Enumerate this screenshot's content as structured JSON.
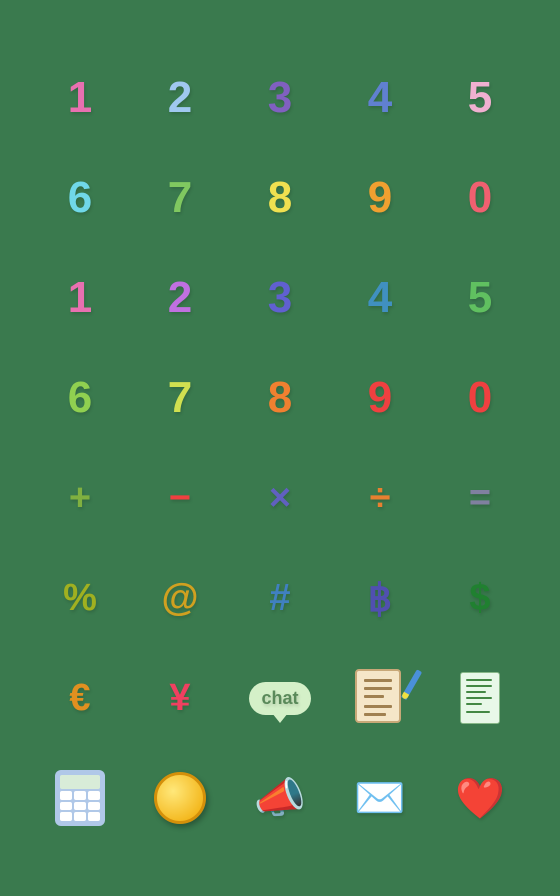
{
  "background": "#3a7a4e",
  "rows": [
    {
      "cells": [
        {
          "label": "1",
          "color": "#e870b0",
          "type": "number"
        },
        {
          "label": "2",
          "color": "#a0c8f0",
          "type": "number"
        },
        {
          "label": "3",
          "color": "#8060c0",
          "type": "number"
        },
        {
          "label": "4",
          "color": "#6080d0",
          "type": "number"
        },
        {
          "label": "5",
          "color": "#f0b0d0",
          "type": "number"
        }
      ]
    },
    {
      "cells": [
        {
          "label": "6",
          "color": "#70d8e8",
          "type": "number"
        },
        {
          "label": "7",
          "color": "#80c860",
          "type": "number"
        },
        {
          "label": "8",
          "color": "#f0e050",
          "type": "number"
        },
        {
          "label": "9",
          "color": "#f0a030",
          "type": "number"
        },
        {
          "label": "0",
          "color": "#f06070",
          "type": "number"
        }
      ]
    },
    {
      "cells": [
        {
          "label": "1",
          "color": "#e870b0",
          "type": "number"
        },
        {
          "label": "2",
          "color": "#c070e0",
          "type": "number"
        },
        {
          "label": "3",
          "color": "#6060d0",
          "type": "number"
        },
        {
          "label": "4",
          "color": "#4090c0",
          "type": "number"
        },
        {
          "label": "5",
          "color": "#60c060",
          "type": "number"
        }
      ]
    },
    {
      "cells": [
        {
          "label": "6",
          "color": "#90d050",
          "type": "number"
        },
        {
          "label": "7",
          "color": "#d0e050",
          "type": "number"
        },
        {
          "label": "8",
          "color": "#f08030",
          "type": "number"
        },
        {
          "label": "9",
          "color": "#f04040",
          "type": "number"
        },
        {
          "label": "0",
          "color": "#f04040",
          "type": "number"
        }
      ]
    },
    {
      "cells": [
        {
          "label": "+",
          "color": "#80b040",
          "type": "symbol"
        },
        {
          "label": "−",
          "color": "#f04040",
          "type": "symbol"
        },
        {
          "label": "×",
          "color": "#6060c0",
          "type": "symbol"
        },
        {
          "label": "÷",
          "color": "#e88030",
          "type": "symbol"
        },
        {
          "label": "=",
          "color": "#8080a0",
          "type": "symbol"
        }
      ]
    },
    {
      "cells": [
        {
          "label": "%",
          "color": "#a0b020",
          "type": "symbol"
        },
        {
          "label": "@",
          "color": "#d0a020",
          "type": "symbol"
        },
        {
          "label": "#",
          "color": "#4080c0",
          "type": "symbol"
        },
        {
          "label": "฿",
          "color": "#5050b0",
          "type": "symbol"
        },
        {
          "label": "$",
          "color": "#208030",
          "type": "symbol"
        }
      ]
    },
    {
      "cells": [
        {
          "label": "€",
          "color": "#e09020",
          "type": "symbol"
        },
        {
          "label": "¥",
          "color": "#f04060",
          "type": "symbol"
        },
        {
          "label": "chat",
          "color": "#5a8a5a",
          "type": "chat"
        },
        {
          "label": "notepad",
          "color": "",
          "type": "notepad"
        },
        {
          "label": "receipt",
          "color": "",
          "type": "receipt"
        }
      ]
    },
    {
      "cells": [
        {
          "label": "calculator",
          "color": "",
          "type": "calculator"
        },
        {
          "label": "coin",
          "color": "",
          "type": "coin"
        },
        {
          "label": "megaphone",
          "color": "#e84040",
          "type": "emoji"
        },
        {
          "label": "envelope",
          "color": "#80b0e0",
          "type": "emoji"
        },
        {
          "label": "hearts",
          "color": "#f04060",
          "type": "emoji"
        }
      ]
    }
  ]
}
